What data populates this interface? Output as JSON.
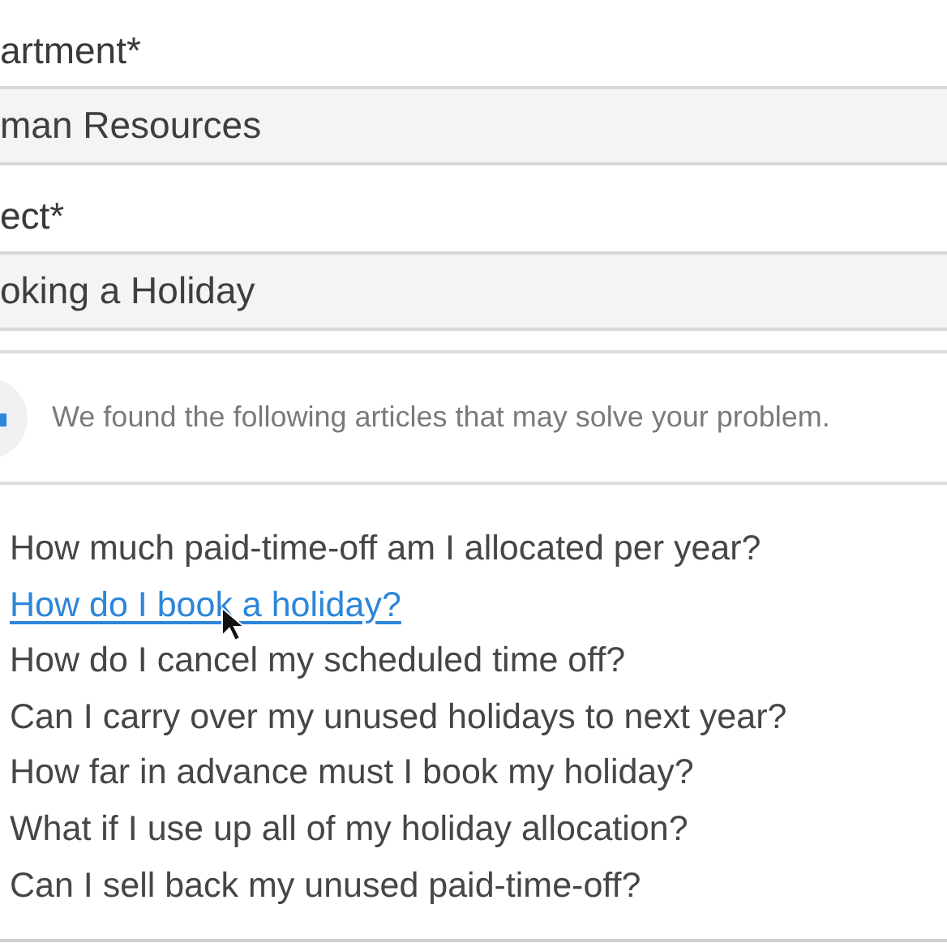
{
  "fields": [
    {
      "label": "artment*",
      "value": "man Resources"
    },
    {
      "label": "ect*",
      "value": "oking a Holiday"
    }
  ],
  "notice": {
    "text": "We found the following articles that may solve your problem."
  },
  "articles": [
    {
      "text": "How much paid-time-off am I allocated per year?",
      "hovered": false
    },
    {
      "text": "How do I book a holiday?",
      "hovered": true
    },
    {
      "text": "How do I cancel my scheduled time off?",
      "hovered": false
    },
    {
      "text": "Can I carry over my unused holidays to next year?",
      "hovered": false
    },
    {
      "text": "How far in advance must I book my holiday?",
      "hovered": false
    },
    {
      "text": "What if I use up all of my holiday allocation?",
      "hovered": false
    },
    {
      "text": "Can I sell back my unused paid-time-off?",
      "hovered": false
    }
  ]
}
